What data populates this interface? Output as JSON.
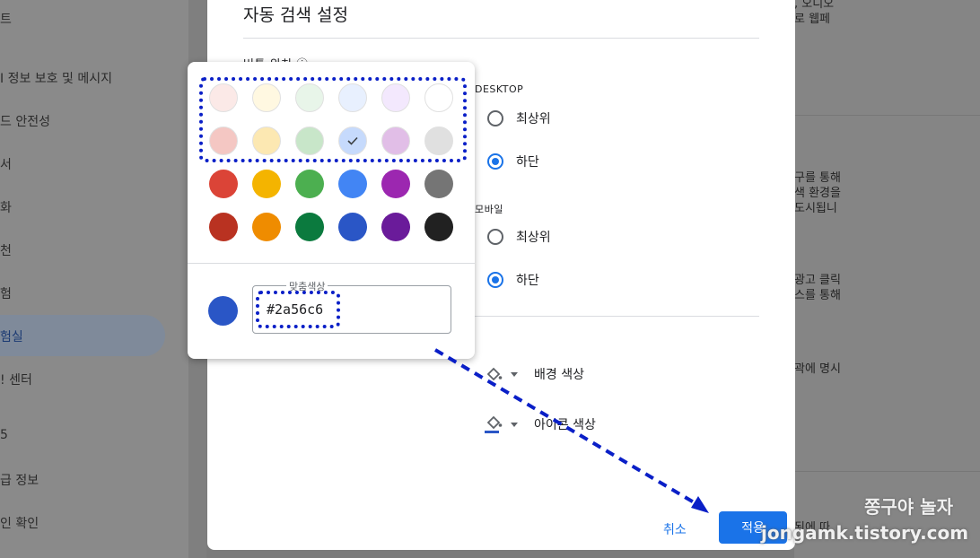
{
  "sidebar": {
    "items": [
      {
        "label": "트"
      },
      {
        "label": "I 정보 보호 및 메시지"
      },
      {
        "label": "드 안전성"
      },
      {
        "label": "서"
      },
      {
        "label": "화"
      },
      {
        "label": "천"
      },
      {
        "label": "험"
      },
      {
        "label": "험실"
      },
      {
        "label": "! 센터"
      },
      {
        "label": "5"
      },
      {
        "label": "급 정보"
      },
      {
        "label": "인 확인"
      }
    ]
  },
  "right_panel": {
    "lines": [
      ", 오디오",
      "로 웹페",
      "구를 통해",
      "색 환경을",
      "도시됩니",
      "광고 클릭",
      "스를 통해",
      "곽에 명시",
      "된에 따"
    ]
  },
  "dialog": {
    "title": "자동 검색 설정",
    "partial_label": "버튼 위치 ⓘ",
    "desktop_label": "DESKTOP",
    "desktop_options": [
      {
        "label": "최상위",
        "checked": false
      },
      {
        "label": "하단",
        "checked": true
      }
    ],
    "mobile_label": "모바일",
    "mobile_options": [
      {
        "label": "최상위",
        "checked": false
      },
      {
        "label": "하단",
        "checked": true
      }
    ],
    "background_color_label": "배경 색상",
    "icon_color_label": "아이콘 색상",
    "icon_color": "#2a56c6",
    "cancel_label": "취소",
    "apply_label": "적용"
  },
  "color_picker": {
    "rows": [
      [
        "#fbe9e7",
        "#fff8e1",
        "#e8f5e9",
        "#e8f0fe",
        "#f3e8fd",
        "#ffffff"
      ],
      [
        "#f4c7c3",
        "#fce8b2",
        "#c8e6c9",
        "#c6dafc",
        "#e1bee7",
        "#e0e0e0"
      ],
      [
        "#db4437",
        "#f4b400",
        "#4caf50",
        "#4285f4",
        "#9c27b0",
        "#757575"
      ],
      [
        "#b93221",
        "#ef8c00",
        "#0b7a3e",
        "#2a56c6",
        "#6a1b9a",
        "#212121"
      ]
    ],
    "selected_row": 1,
    "selected_col": 3,
    "custom_color_label": "맞춤색상",
    "hex_value": "#2a56c6",
    "current_color": "#2a56c6"
  },
  "watermark": {
    "name": "쫑구야 놀자",
    "url": "jongamk.tistory.com"
  }
}
